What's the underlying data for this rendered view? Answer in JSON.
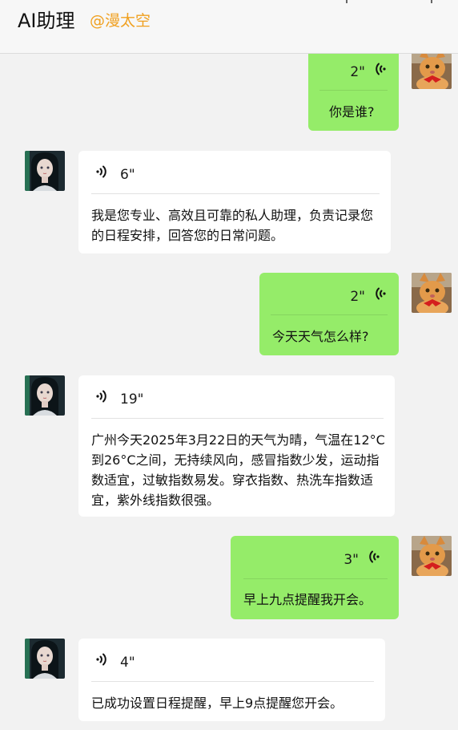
{
  "header": {
    "title": "AI助理",
    "handle": "@漫太空"
  },
  "messages": [
    {
      "sender": "me",
      "duration": "2\"",
      "text": "你是谁?"
    },
    {
      "sender": "ai",
      "duration": "6\"",
      "text": "我是您专业、高效且可靠的私人助理，负责记录您的日程安排，回答您的日常问题。"
    },
    {
      "sender": "me",
      "duration": "2\"",
      "text": "今天天气怎么样?"
    },
    {
      "sender": "ai",
      "duration": "19\"",
      "text": "广州今天2025年3月22日的天气为晴，气温在12°C到26°C之间，无持续风向，感冒指数少发，运动指数适宜，过敏指数易发。穿衣指数、热洗车指数适宜，紫外线指数很强。"
    },
    {
      "sender": "me",
      "duration": "3\"",
      "text": "早上九点提醒我开会。"
    },
    {
      "sender": "ai",
      "duration": "4\"",
      "text": "已成功设置日程提醒，早上9点提醒您开会。"
    }
  ],
  "icons": {
    "voice": "voice-wave-icon",
    "user_avatar": "cat-avatar-icon",
    "ai_avatar": "ai-girl-avatar-icon"
  },
  "colors": {
    "my_bubble": "#95ec69",
    "ai_bubble": "#ffffff",
    "handle": "#f0a020",
    "background": "#f2f2f2"
  }
}
